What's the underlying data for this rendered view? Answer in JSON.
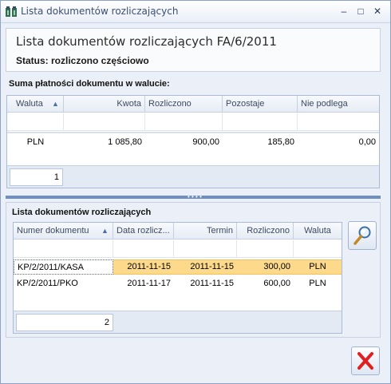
{
  "window": {
    "title": "Lista dokumentów rozliczających",
    "minimize_glyph": "‒",
    "maximize_glyph": "□",
    "close_glyph": "✕"
  },
  "header": {
    "doc_title": "Lista dokumentów rozliczających FA/6/2011",
    "status": "Status: rozliczono częściowo"
  },
  "payments": {
    "section_label": "Suma płatności dokumentu w walucie:",
    "columns": [
      "Waluta",
      "Kwota",
      "Rozliczono",
      "Pozostaje",
      "Nie podlega"
    ],
    "sort_icon": "sort-ascending-icon",
    "rows": [
      {
        "waluta": "PLN",
        "kwota": "1 085,80",
        "rozliczono": "900,00",
        "pozostaje": "185,80",
        "nie_podlega": "0,00"
      }
    ],
    "count": "1"
  },
  "documents": {
    "section_label": "Lista dokumentów rozliczających",
    "columns": [
      "Numer dokumentu",
      "Data rozlicz...",
      "Termin",
      "Rozliczono",
      "Waluta"
    ],
    "rows": [
      {
        "numer": "KP/2/2011/KASA",
        "data": "2011-11-15",
        "termin": "2011-11-15",
        "rozliczono": "300,00",
        "waluta": "PLN",
        "selected": true
      },
      {
        "numer": "KP/2/2011/PKO",
        "data": "2011-11-17",
        "termin": "2011-11-15",
        "rozliczono": "600,00",
        "waluta": "PLN",
        "selected": false
      }
    ],
    "count": "2"
  },
  "icons": {
    "preview": "magnifier-icon",
    "close": "close-red-x-icon",
    "app": "app-icon"
  },
  "colors": {
    "selected_row": "#fcd98b",
    "selected_row_edge": "#f3c25b",
    "close_x": "#e02020",
    "splitter": "#6f8fc2"
  }
}
